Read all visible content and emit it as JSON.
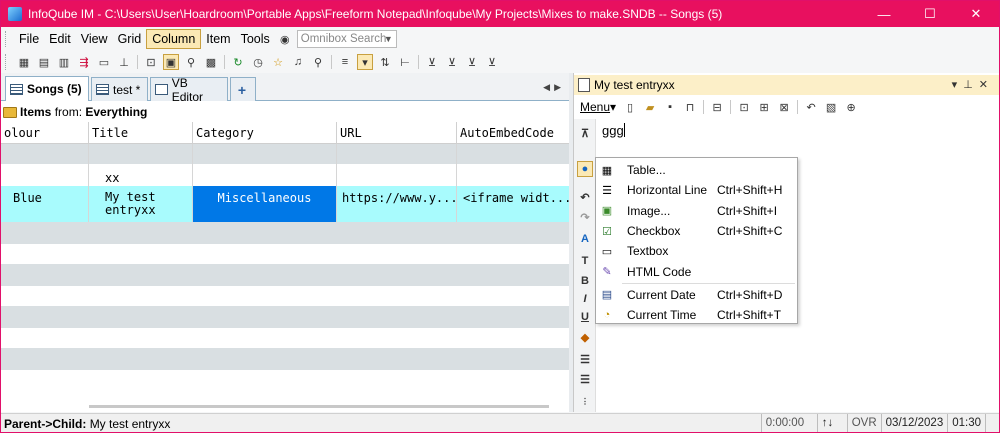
{
  "window": {
    "title": "InfoQube IM - C:\\Users\\User\\Hoardroom\\Portable Apps\\Freeform Notepad\\Infoqube\\My Projects\\Mixes to make.SNDB -- Songs (5)",
    "controls": {
      "minimize": "—",
      "maximize": "☐",
      "close": "✕"
    }
  },
  "menubar": {
    "items": [
      "File",
      "Edit",
      "View",
      "Grid",
      "Column",
      "Item",
      "Tools"
    ],
    "omnibox_placeholder": "Omnibox Search"
  },
  "tabs": [
    {
      "label": "Songs (5)",
      "active": true
    },
    {
      "label": "test *",
      "active": false
    },
    {
      "label": "VB Editor",
      "active": false
    },
    {
      "label": "+",
      "active": false
    }
  ],
  "items_from": {
    "prefix": "Items",
    "mid": " from: ",
    "source": "Everything"
  },
  "grid": {
    "columns": [
      "olour",
      "Title",
      "Category",
      "URL",
      "AutoEmbedCode"
    ],
    "rows": [
      {
        "colour": "",
        "title": "",
        "category": "",
        "url": "",
        "embed": ""
      },
      {
        "colour": "",
        "title": "xx",
        "category": "",
        "url": "",
        "embed": ""
      },
      {
        "colour": "Blue",
        "title": "My test entryxx",
        "category": "Miscellaneous",
        "url": "https://www.y...",
        "embed": "<iframe widt..."
      }
    ]
  },
  "right_pane": {
    "title": "My test entryxx",
    "menu_label": "Menu",
    "editor_text": "ggg"
  },
  "insert_menu": {
    "items": [
      {
        "label": "Table...",
        "shortcut": "",
        "icon": "table-icon"
      },
      {
        "label": "Horizontal Line",
        "shortcut": "Ctrl+Shift+H",
        "icon": "horizontal-line-icon"
      },
      {
        "label": "Image...",
        "shortcut": "Ctrl+Shift+I",
        "icon": "image-icon"
      },
      {
        "label": "Checkbox",
        "shortcut": "Ctrl+Shift+C",
        "icon": "checkbox-icon"
      },
      {
        "label": "Textbox",
        "shortcut": "",
        "icon": "textbox-icon"
      },
      {
        "label": "HTML Code",
        "shortcut": "",
        "icon": "html-code-icon"
      },
      {
        "label": "Current Date",
        "shortcut": "Ctrl+Shift+D",
        "icon": "calendar-icon"
      },
      {
        "label": "Current Time",
        "shortcut": "Ctrl+Shift+T",
        "icon": "clock-icon"
      }
    ]
  },
  "statusbar": {
    "left_label": "Parent->Child:",
    "left_value": "My test entryxx",
    "timer": "0:00:00",
    "ovr": "OVR",
    "date": "03/12/2023",
    "time": "01:30"
  },
  "colors": {
    "titlebar": "#e8105f",
    "selected_row": "#a8fbfd",
    "selected_cell": "#0078e7",
    "alt_row": "#d9dfe2"
  }
}
